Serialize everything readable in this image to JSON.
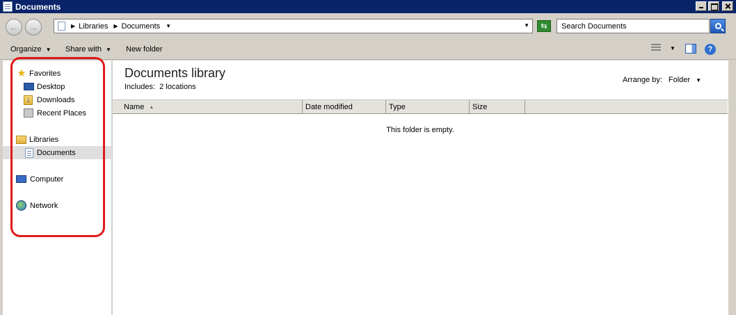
{
  "window": {
    "title": "Documents"
  },
  "address": {
    "crumbs": [
      "Libraries",
      "Documents"
    ],
    "search_placeholder": "Search Documents"
  },
  "toolbar": {
    "organize": "Organize",
    "share_with": "Share with",
    "new_folder": "New folder"
  },
  "nav": {
    "favorites": "Favorites",
    "desktop": "Desktop",
    "downloads": "Downloads",
    "recent_places": "Recent Places",
    "libraries": "Libraries",
    "documents": "Documents",
    "computer": "Computer",
    "network": "Network"
  },
  "content": {
    "title": "Documents library",
    "includes_label": "Includes:",
    "includes_value": "2 locations",
    "arrange_label": "Arrange by:",
    "arrange_value": "Folder",
    "columns": [
      "Name",
      "Date modified",
      "Type",
      "Size"
    ],
    "empty_message": "This folder is empty."
  },
  "annotation": {
    "highlight_color": "#e01a1a"
  }
}
